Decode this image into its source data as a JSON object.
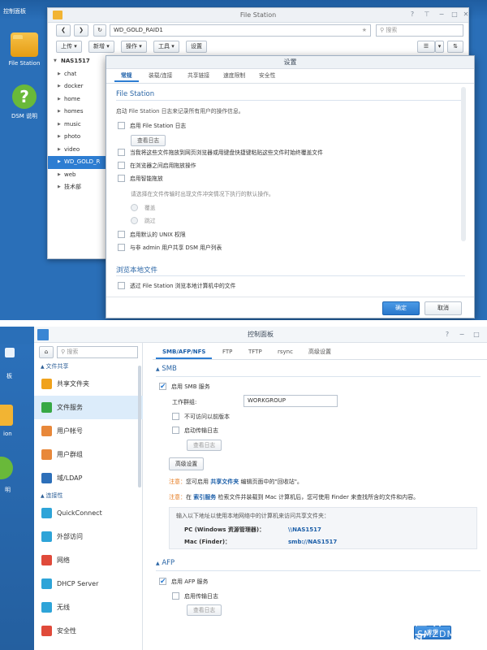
{
  "shot1": {
    "desktop": {
      "top_label": "控制面板",
      "icons": [
        {
          "label": "File Station",
          "icon": "folder-icon"
        },
        {
          "label": "DSM 说明",
          "icon": "help-icon"
        }
      ]
    },
    "file_station": {
      "title": "File Station",
      "path": "WD_GOLD_RAID1",
      "search_placeholder": "搜索",
      "toolbar": [
        "上传 ▾",
        "新增 ▾",
        "操作 ▾",
        "工具 ▾",
        "设置"
      ],
      "tree_root": "NAS1517",
      "tree_items": [
        "chat",
        "docker",
        "home",
        "homes",
        "music",
        "photo",
        "video",
        "WD_GOLD_R",
        "web",
        "技术部"
      ],
      "selected_item": "WD_GOLD_R"
    },
    "settings": {
      "title": "设置",
      "tabs": [
        "常规",
        "装载/连接",
        "共享链接",
        "速度限制",
        "安全性"
      ],
      "active_tab": "常规",
      "section1": "File Station",
      "section1_desc": "启动 File Station 日志来记录所有用户的操作信息。",
      "enable_log": "启用 File Station 日志",
      "view_log": "查看日志",
      "opt_overwrite": "当我将这些文件拖放到网页浏览器或用键盘快捷键粘贴这些文件时始终覆盖文件",
      "opt_browser_drag": "在浏览器之间启用拖放操作",
      "opt_smart_drag": "启用智能拖放",
      "smart_drag_desc": "请选择在文件传输时出现文件冲突情况下执行的默认操作。",
      "radio_overwrite": "覆盖",
      "radio_skip": "跳过",
      "opt_unix": "启用默认的 UNIX 权限",
      "opt_share_dsm": "与非 admin 用户共享 DSM 用户列表",
      "section2": "浏览本地文件",
      "opt_local": "透过 File Station 浏览本地计算机中的文件",
      "ok": "确定",
      "cancel": "取消"
    }
  },
  "shot2": {
    "desktop_fragments": [
      "板",
      "ion",
      "明"
    ],
    "control_panel": {
      "title": "控制面板",
      "search_placeholder": "搜索",
      "groups": [
        {
          "header": "文件共享",
          "items": [
            {
              "label": "共享文件夹",
              "icon": "shared-folder-icon",
              "color": "#f0a21c"
            },
            {
              "label": "文件服务",
              "icon": "file-services-icon",
              "color": "#37a845"
            },
            {
              "label": "用户帐号",
              "icon": "user-icon",
              "color": "#e8883a"
            },
            {
              "label": "用户群组",
              "icon": "group-icon",
              "color": "#e8883a"
            },
            {
              "label": "域/LDAP",
              "icon": "domain-icon",
              "color": "#2d6fb9"
            }
          ]
        },
        {
          "header": "连接性",
          "items": [
            {
              "label": "QuickConnect",
              "icon": "quickconnect-icon",
              "color": "#2ea4d8"
            },
            {
              "label": "外部访问",
              "icon": "external-access-icon",
              "color": "#2ea4d8"
            },
            {
              "label": "网络",
              "icon": "network-icon",
              "color": "#e04a3a"
            },
            {
              "label": "DHCP Server",
              "icon": "dhcp-icon",
              "color": "#2ea4d8"
            },
            {
              "label": "无线",
              "icon": "wireless-icon",
              "color": "#2ea4d8"
            },
            {
              "label": "安全性",
              "icon": "security-icon",
              "color": "#e04a3a"
            }
          ]
        }
      ],
      "selected": "文件服务",
      "tabs": [
        "SMB/AFP/NFS",
        "FTP",
        "TFTP",
        "rsync",
        "高级设置"
      ],
      "active_tab": "SMB/AFP/NFS",
      "smb": {
        "header": "SMB",
        "enable": "启用 SMB 服务",
        "workgroup_label": "工作群组:",
        "workgroup_value": "WORKGROUP",
        "no_prev_versions": "不可访问以前版本",
        "transfer_log": "启动传输日志",
        "view_log": "查看日志",
        "advanced": "高级设置",
        "note_label": "注意：",
        "note1_a": "您可启用",
        "note1_link": "共享文件夹",
        "note1_b": "编辑页面中的\"回收站\"。",
        "note2_a": "在",
        "note2_link": "索引服务",
        "note2_b": "检索文件并装载到 Mac 计算机后，您可使用 Finder 来查找所含的文件和内容。",
        "info_intro": "输入以下地址以使用本地网络中的计算机来访问共享文件夹：",
        "pc_label": "PC (Windows 资源管理器)：",
        "pc_value": "\\\\NAS1517",
        "mac_label": "Mac (Finder)：",
        "mac_value": "smb://NAS1517"
      },
      "afp": {
        "header": "AFP",
        "enable": "启用 AFP 服务",
        "transfer_log": "启用传输日志",
        "view_log": "查看日志"
      },
      "apply": "应用"
    },
    "watermark": {
      "main": "值 什么值得买",
      "sub": "SMZDM.COM"
    }
  },
  "colors": {
    "accent": "#2d7dd2",
    "desktop": "#2a6fb8",
    "link": "#1b5ea8",
    "note": "#e67a1e"
  }
}
